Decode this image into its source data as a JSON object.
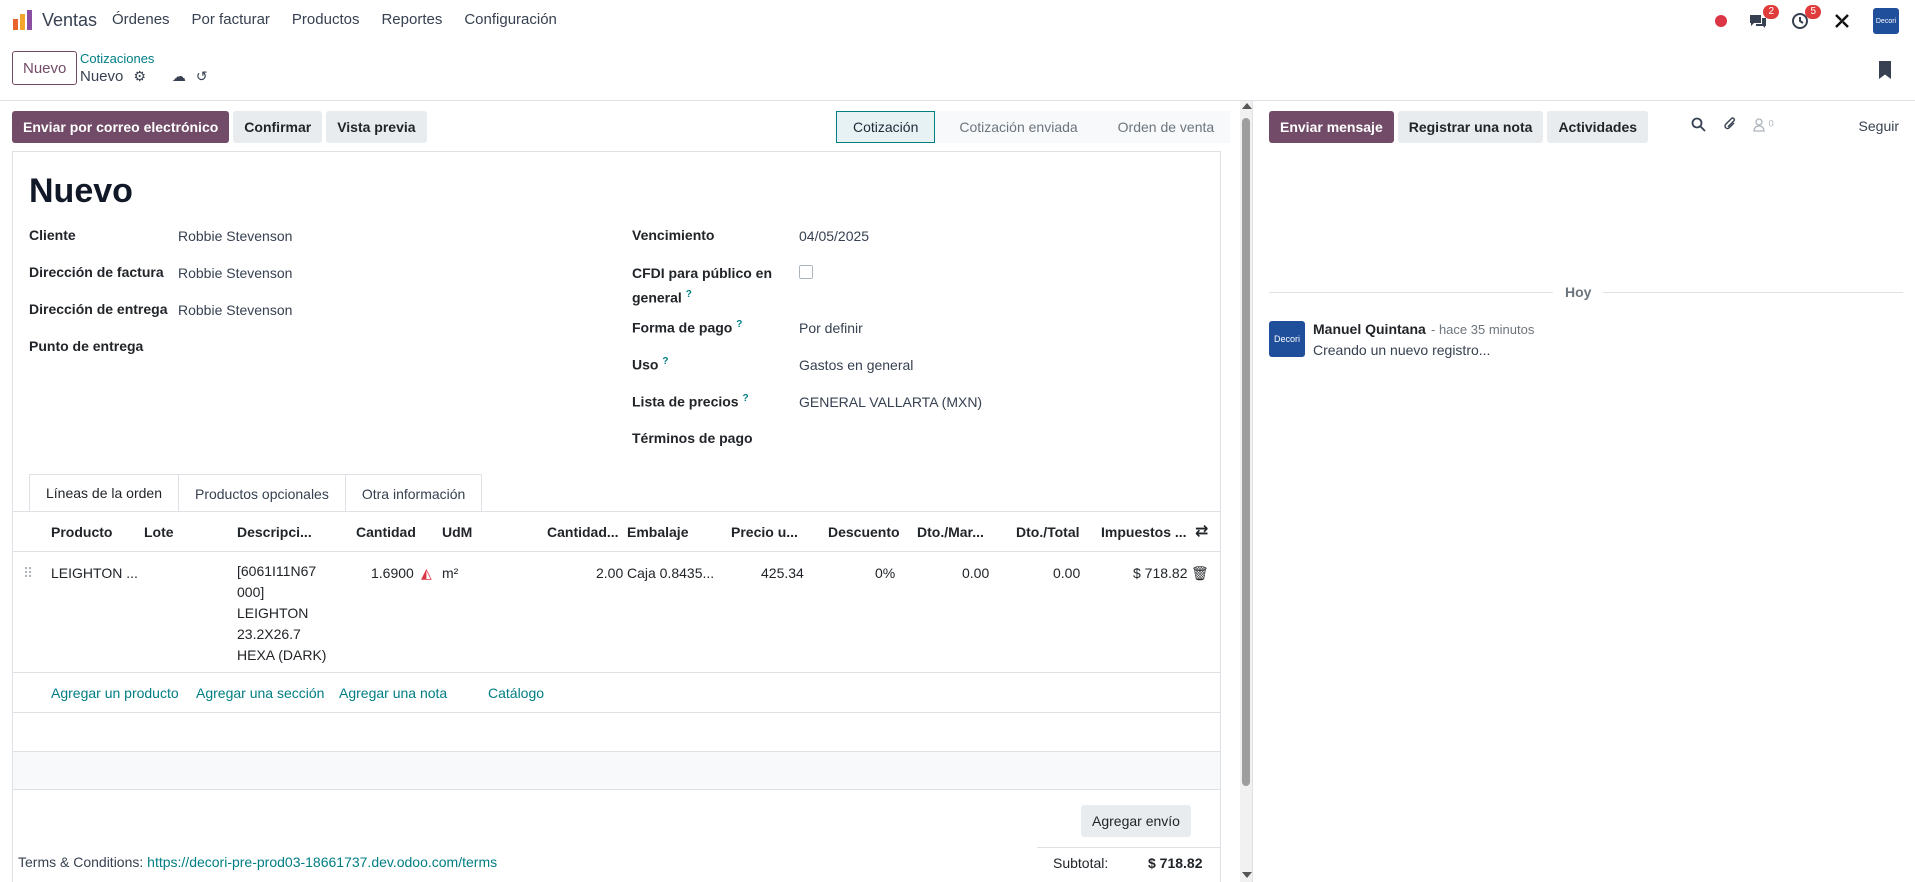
{
  "app": {
    "name": "Ventas"
  },
  "menu": [
    "Órdenes",
    "Por facturar",
    "Productos",
    "Reportes",
    "Configuración"
  ],
  "systray": {
    "messages_badge": "2",
    "activities_badge": "5",
    "avatar_text": "Decori"
  },
  "control": {
    "new_button": "Nuevo",
    "breadcrumb": "Cotizaciones",
    "current": "Nuevo"
  },
  "actions": {
    "email": "Enviar por correo electrónico",
    "confirm": "Confirmar",
    "preview": "Vista previa"
  },
  "stages": [
    "Cotización",
    "Cotización enviada",
    "Orden de venta"
  ],
  "form": {
    "title": "Nuevo",
    "left": [
      {
        "label": "Cliente",
        "value": "Robbie Stevenson"
      },
      {
        "label": "Dirección de factura",
        "value": "Robbie Stevenson"
      },
      {
        "label": "Dirección de entrega",
        "value": "Robbie Stevenson"
      },
      {
        "label": "Punto de entrega",
        "value": ""
      }
    ],
    "right": {
      "vencimiento_label": "Vencimiento",
      "vencimiento": "04/05/2025",
      "cfdi_label_1": "CFDI para público en",
      "cfdi_label_2": "general",
      "forma_label": "Forma de pago",
      "forma": "Por definir",
      "uso_label": "Uso",
      "uso": "Gastos en general",
      "lista_label": "Lista de precios",
      "lista": "GENERAL VALLARTA (MXN)",
      "terminos_label": "Términos de pago"
    },
    "help_mark": "?"
  },
  "tabs": [
    "Líneas de la orden",
    "Productos opcionales",
    "Otra información"
  ],
  "table": {
    "headers": [
      "Producto",
      "Lote",
      "Descripci...",
      "Cantidad",
      "UdM",
      "Cantidad...",
      "Embalaje",
      "Precio u...",
      "Descuento",
      "Dto./Mar...",
      "Dto./Total",
      "Impuestos ..."
    ],
    "row": {
      "producto": "LEIGHTON ...",
      "descripcion": "[6061I11N67 000] LEIGHTON 23.2X26.7 HEXA (DARK)",
      "cantidad": "1.6900",
      "udm": "m²",
      "cantidad2": "2.00",
      "embalaje": "Caja 0.8435...",
      "precio": "425.34",
      "descuento": "0%",
      "dto_mar": "0.00",
      "dto_total": "0.00",
      "impuestos": "$ 718.82"
    },
    "add_links": [
      "Agregar un producto",
      "Agregar una sección",
      "Agregar una nota",
      "Catálogo"
    ]
  },
  "footer": {
    "shipping_button": "Agregar envío",
    "terms_label": "Terms & Conditions:",
    "terms_link": "https://decori-pre-prod03-18661737.dev.odoo.com/terms",
    "subtotal_label": "Subtotal:",
    "subtotal_value": "$ 718.82"
  },
  "chatter": {
    "send_message": "Enviar mensaje",
    "log_note": "Registrar una nota",
    "activities": "Actividades",
    "followers_count": "0",
    "follow": "Seguir",
    "day": "Hoy",
    "author": "Manuel Quintana",
    "time": "- hace 35 minutos",
    "body": "Creando un nuevo registro...",
    "avatar_text": "Decori"
  },
  "colors": {
    "primary": "#714b67",
    "link": "#017e84"
  }
}
